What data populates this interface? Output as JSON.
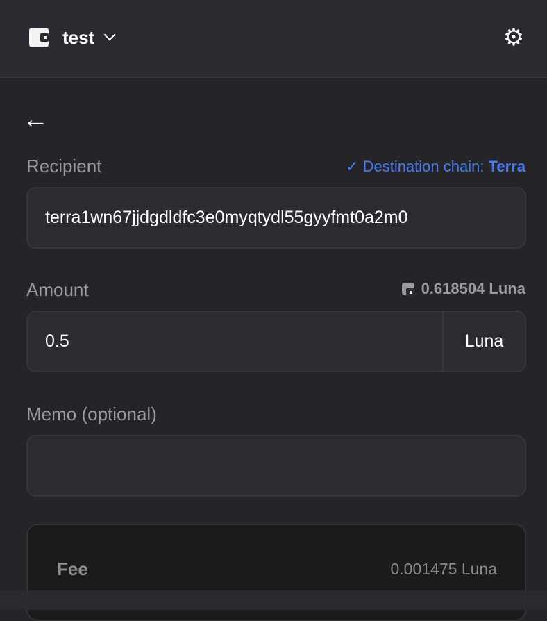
{
  "header": {
    "wallet_name": "test",
    "wallet_icon": "wallet-icon",
    "settings_icon": "gear-icon"
  },
  "back_icon": "arrow-left-icon",
  "recipient": {
    "label": "Recipient",
    "chain_prefix": "Destination chain:",
    "chain_name": "Terra",
    "chain_color": "#4a7aee",
    "value": "terra1wn67jjdgdldfc3e0myqtydl55gyyfmt0a2m0"
  },
  "amount": {
    "label": "Amount",
    "balance": "0.618504 Luna",
    "value": "0.5",
    "unit": "Luna"
  },
  "memo": {
    "label": "Memo (optional)",
    "value": ""
  },
  "fee": {
    "label": "Fee",
    "value": "0.001475 Luna"
  }
}
